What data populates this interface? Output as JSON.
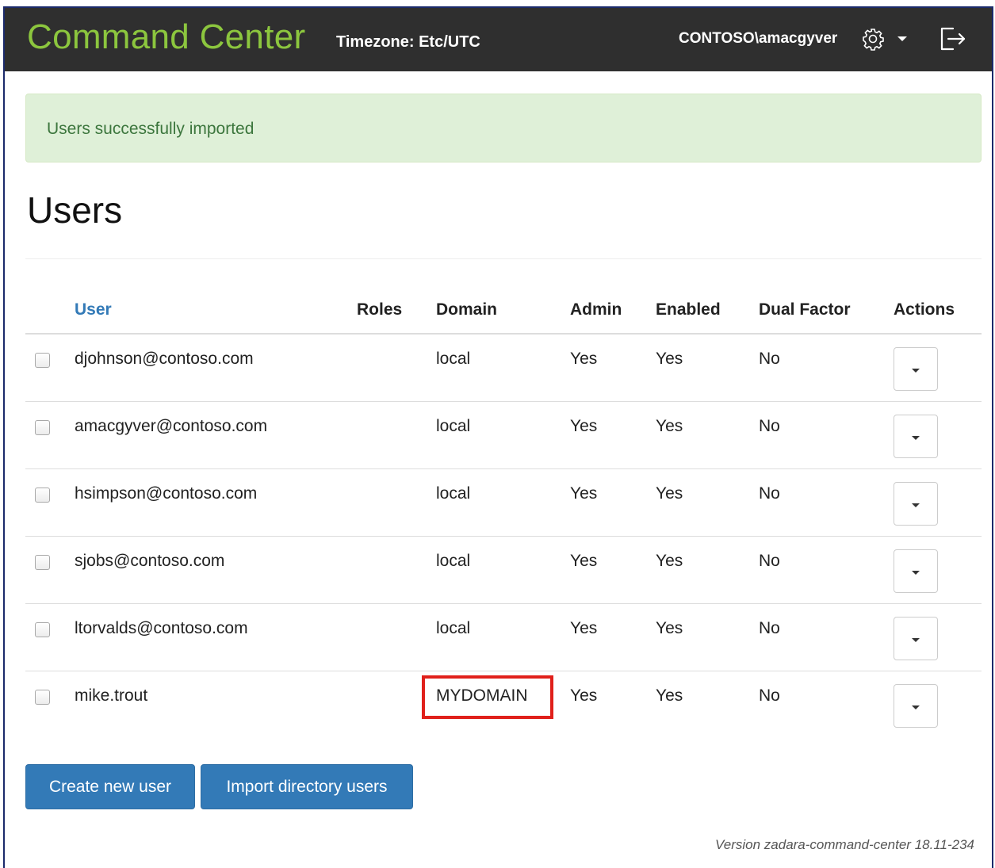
{
  "header": {
    "brand": "Command Center",
    "timezone": "Timezone: Etc/UTC",
    "user": "CONTOSO\\amacgyver"
  },
  "alert": {
    "message": "Users successfully imported"
  },
  "page": {
    "title": "Users"
  },
  "table": {
    "columns": {
      "user": "User",
      "roles": "Roles",
      "domain": "Domain",
      "admin": "Admin",
      "enabled": "Enabled",
      "dual_factor": "Dual Factor",
      "actions": "Actions"
    },
    "rows": [
      {
        "user": "djohnson@contoso.com",
        "roles": "",
        "domain": "local",
        "admin": "Yes",
        "enabled": "Yes",
        "dual_factor": "No"
      },
      {
        "user": "amacgyver@contoso.com",
        "roles": "",
        "domain": "local",
        "admin": "Yes",
        "enabled": "Yes",
        "dual_factor": "No"
      },
      {
        "user": "hsimpson@contoso.com",
        "roles": "",
        "domain": "local",
        "admin": "Yes",
        "enabled": "Yes",
        "dual_factor": "No"
      },
      {
        "user": "sjobs@contoso.com",
        "roles": "",
        "domain": "local",
        "admin": "Yes",
        "enabled": "Yes",
        "dual_factor": "No"
      },
      {
        "user": "ltorvalds@contoso.com",
        "roles": "",
        "domain": "local",
        "admin": "Yes",
        "enabled": "Yes",
        "dual_factor": "No"
      },
      {
        "user": "mike.trout",
        "roles": "",
        "domain": "MYDOMAIN",
        "admin": "Yes",
        "enabled": "Yes",
        "dual_factor": "No",
        "highlighted": true
      }
    ]
  },
  "buttons": {
    "create": "Create new user",
    "import": "Import directory users"
  },
  "footer": {
    "version": "Version zadara-command-center 18.11-234"
  },
  "icons": {
    "settings": "gear-icon",
    "settings_menu": "caret-down-icon",
    "logout": "logout-icon",
    "row_actions": "caret-down-icon"
  },
  "colors": {
    "brand": "#8cc63e",
    "navbar": "#2f2f2f",
    "alert_bg": "#dff0d8",
    "alert_text": "#3c763d",
    "link": "#337ab7",
    "primary_button": "#337ab7",
    "highlight_border": "#e0201b"
  }
}
